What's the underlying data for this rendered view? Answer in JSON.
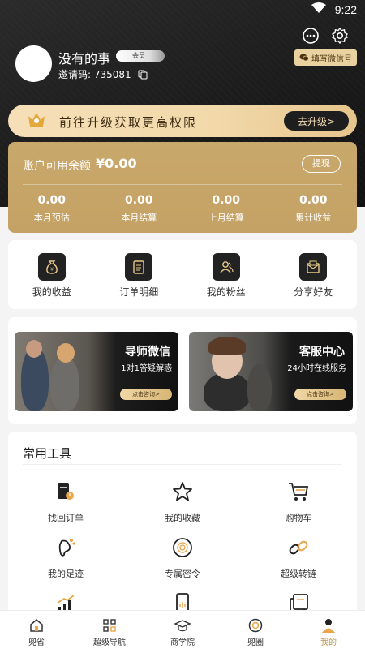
{
  "status_bar": {
    "time": "9:22"
  },
  "profile": {
    "nickname": "没有的事",
    "member_badge": "会员",
    "invite_label": "邀请码:",
    "invite_code": "735081",
    "wechat_button": "填写微信号"
  },
  "upgrade": {
    "text": "前往升级获取更高权限",
    "button": "去升级>"
  },
  "balance": {
    "label": "账户可用余额",
    "value": "¥0.00",
    "withdraw": "提现",
    "stats": [
      {
        "value": "0.00",
        "label": "本月预估"
      },
      {
        "value": "0.00",
        "label": "本月结算"
      },
      {
        "value": "0.00",
        "label": "上月结算"
      },
      {
        "value": "0.00",
        "label": "累计收益"
      }
    ]
  },
  "quick_actions": [
    {
      "label": "我的收益",
      "icon": "money-bag-icon"
    },
    {
      "label": "订单明细",
      "icon": "clipboard-icon"
    },
    {
      "label": "我的粉丝",
      "icon": "people-icon"
    },
    {
      "label": "分享好友",
      "icon": "envelope-icon"
    }
  ],
  "promos": [
    {
      "title": "导师微信",
      "subtitle": "1对1答疑解惑",
      "button": "点击咨询>"
    },
    {
      "title": "客服中心",
      "subtitle": "24小时在线服务",
      "button": "点击咨询>"
    }
  ],
  "tools": {
    "title": "常用工具",
    "items": [
      {
        "label": "找回订单",
        "icon": "order-search-icon"
      },
      {
        "label": "我的收藏",
        "icon": "star-icon"
      },
      {
        "label": "购物车",
        "icon": "cart-icon"
      },
      {
        "label": "我的足迹",
        "icon": "footprint-icon"
      },
      {
        "label": "专属密令",
        "icon": "fingerprint-icon"
      },
      {
        "label": "超级转链",
        "icon": "link-icon"
      },
      {
        "label": "",
        "icon": "chart-icon"
      },
      {
        "label": "",
        "icon": "phone-icon"
      },
      {
        "label": "",
        "icon": "document-icon"
      }
    ]
  },
  "tabbar": [
    {
      "label": "兜省",
      "icon": "home-icon"
    },
    {
      "label": "超级导航",
      "icon": "grid-icon"
    },
    {
      "label": "商学院",
      "icon": "graduation-cap-icon"
    },
    {
      "label": "兜圈",
      "icon": "circle-icon"
    },
    {
      "label": "我的",
      "icon": "profile-icon",
      "active": true
    }
  ],
  "colors": {
    "gold": "#c9a86b",
    "accent_text": "#b8964f",
    "dark": "#1e1e1e"
  }
}
